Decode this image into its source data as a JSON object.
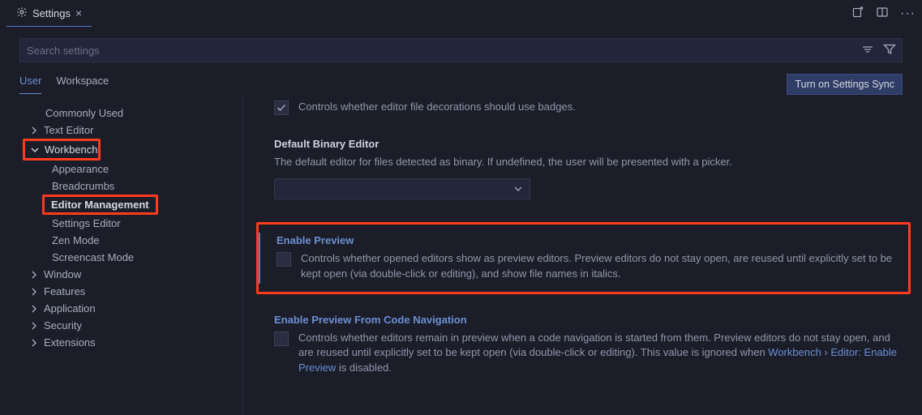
{
  "titlebar": {
    "tab_label": "Settings"
  },
  "search": {
    "placeholder": "Search settings"
  },
  "scopes": {
    "user": "User",
    "workspace": "Workspace",
    "sync_button": "Turn on Settings Sync"
  },
  "sidebar": {
    "commonly_used": "Commonly Used",
    "text_editor": "Text Editor",
    "workbench": "Workbench",
    "appearance": "Appearance",
    "breadcrumbs": "Breadcrumbs",
    "editor_management": "Editor Management",
    "settings_editor": "Settings Editor",
    "zen_mode": "Zen Mode",
    "screencast_mode": "Screencast Mode",
    "window": "Window",
    "features": "Features",
    "application": "Application",
    "security": "Security",
    "extensions": "Extensions"
  },
  "settings": {
    "badges_desc": "Controls whether editor file decorations should use badges.",
    "default_binary_title": "Default Binary Editor",
    "default_binary_desc": "The default editor for files detected as binary. If undefined, the user will be presented with a picker.",
    "enable_preview_title": "Enable Preview",
    "enable_preview_desc": "Controls whether opened editors show as preview editors. Preview editors do not stay open, are reused until explicitly set to be kept open (via double-click or editing), and show file names in italics.",
    "enable_preview_nav_title": "Enable Preview From Code Navigation",
    "enable_preview_nav_desc_1": "Controls whether editors remain in preview when a code navigation is started from them. Preview editors do not stay open, and are reused until explicitly set to be kept open (via double-click or editing). This value is ignored when ",
    "enable_preview_nav_link": "Workbench › Editor: Enable Preview",
    "enable_preview_nav_desc_2": " is disabled."
  }
}
